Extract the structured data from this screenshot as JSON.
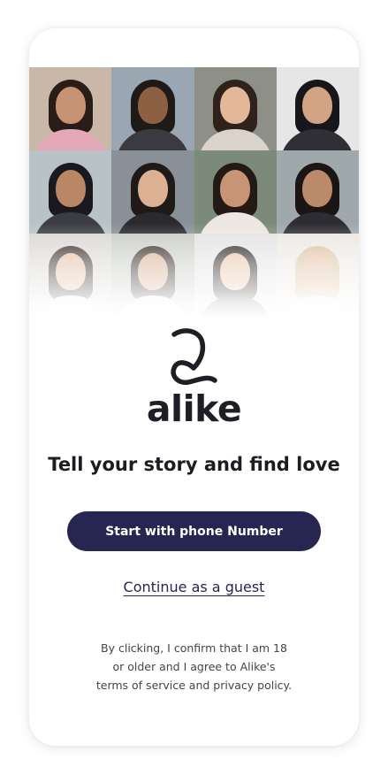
{
  "app": {
    "name": "alike",
    "tagline": "Tell your story and find love"
  },
  "actions": {
    "primary_label": "Start with phone Number",
    "guest_label": "Continue as a guest"
  },
  "legal": {
    "line1": "By clicking, I confirm that I am 18",
    "line2": "or older and I agree to Alike's",
    "line3": "terms of service and privacy policy."
  },
  "photo_grid": {
    "count": 12,
    "icon": "profile-photo"
  },
  "colors": {
    "primary": "#262650",
    "text": "#1c1c22",
    "card_bg": "#ffffff"
  }
}
